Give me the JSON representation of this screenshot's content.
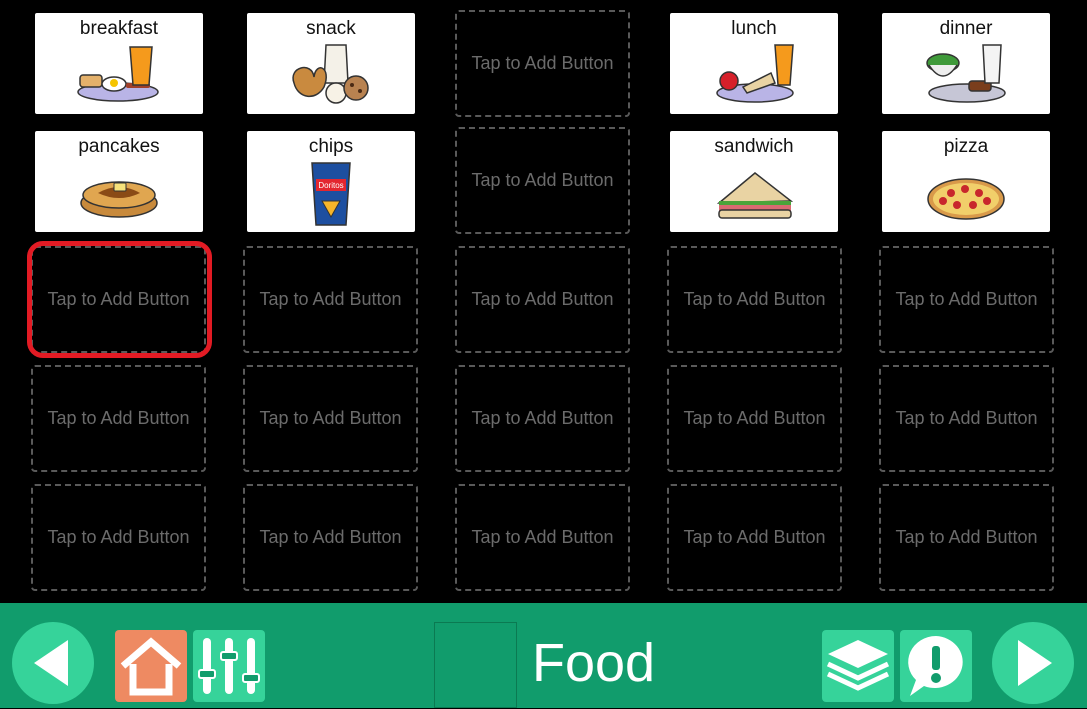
{
  "board": {
    "title": "Food",
    "empty_label": "Tap to Add Button",
    "filled": {
      "breakfast": "breakfast",
      "snack": "snack",
      "lunch": "lunch",
      "dinner": "dinner",
      "pancakes": "pancakes",
      "chips": "chips",
      "sandwich": "sandwich",
      "pizza": "pizza",
      "chips_brand": "Doritos"
    }
  },
  "toolbar": {
    "icons": {
      "back": "back-arrow-icon",
      "home": "home-icon",
      "settings": "sliders-icon",
      "pages": "layers-icon",
      "alert": "alert-bubble-icon",
      "forward": "forward-arrow-icon"
    }
  },
  "colors": {
    "toolbar_bg": "#119c6c",
    "round_button": "#36d39a",
    "home_button": "#ee8a62",
    "highlight": "#e21b24"
  }
}
